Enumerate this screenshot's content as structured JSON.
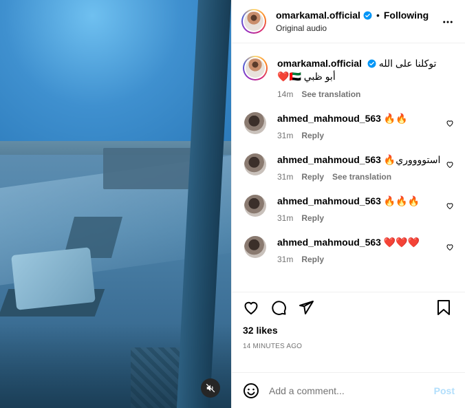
{
  "post": {
    "username": "omarkamal.official",
    "separator": "•",
    "follow_state": "Following",
    "audio": "Original audio",
    "more_icon": "more-horizontal-icon"
  },
  "caption": {
    "username": "omarkamal.official",
    "text": "توكلنا على الله أبو ظبي 🇦🇪❤️",
    "time": "14m",
    "translate": "See translation"
  },
  "comments": [
    {
      "username": "ahmed_mahmoud_563",
      "text": "🔥🔥",
      "time": "31m",
      "reply": "Reply",
      "translate": ""
    },
    {
      "username": "ahmed_mahmoud_563",
      "text": "استووووري🔥",
      "time": "31m",
      "reply": "Reply",
      "translate": "See translation"
    },
    {
      "username": "ahmed_mahmoud_563",
      "text": "🔥🔥🔥",
      "time": "31m",
      "reply": "Reply",
      "translate": ""
    },
    {
      "username": "ahmed_mahmoud_563",
      "text": "❤️❤️❤️",
      "time": "31m",
      "reply": "Reply",
      "translate": ""
    }
  ],
  "stats": {
    "likes": "32 likes",
    "timestamp": "14 MINUTES AGO"
  },
  "composer": {
    "placeholder": "Add a comment...",
    "post_label": "Post"
  },
  "colors": {
    "verified": "#0095f6",
    "post_disabled": "#b2dffc",
    "meta_gray": "#737373"
  }
}
